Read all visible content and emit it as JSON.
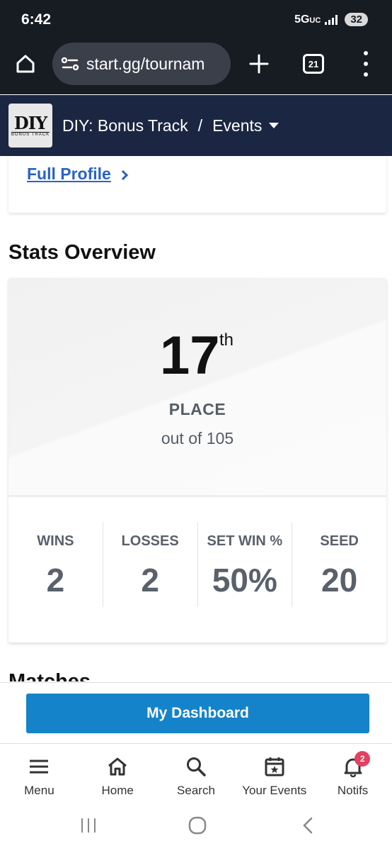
{
  "status_bar": {
    "time": "6:42",
    "network": "5G",
    "network_suffix": "UC",
    "battery": "32"
  },
  "browser": {
    "url": "start.gg/tournam",
    "tab_count": "21"
  },
  "header": {
    "event_name": "DIY: Bonus Track",
    "separator": "/",
    "section": "Events",
    "logo_main": "DIY",
    "logo_sub": "BONUS TRACK"
  },
  "profile": {
    "full_profile_link": "Full Profile"
  },
  "stats": {
    "title": "Stats Overview",
    "placement": {
      "number": "17",
      "suffix": "th",
      "label": "PLACE",
      "out_of": "out of 105"
    },
    "items": [
      {
        "label": "WINS",
        "value": "2"
      },
      {
        "label": "LOSSES",
        "value": "2"
      },
      {
        "label": "SET WIN %",
        "value": "50%"
      },
      {
        "label": "SEED",
        "value": "20"
      }
    ]
  },
  "matches": {
    "title": "Matches"
  },
  "dashboard_button": "My Dashboard",
  "bottom_nav": [
    {
      "label": "Menu",
      "icon": "menu-icon"
    },
    {
      "label": "Home",
      "icon": "home-icon"
    },
    {
      "label": "Search",
      "icon": "search-icon"
    },
    {
      "label": "Your Events",
      "icon": "calendar-star-icon"
    },
    {
      "label": "Notifs",
      "icon": "bell-icon",
      "badge": "2"
    }
  ],
  "colors": {
    "chrome": "#171b22",
    "header": "#1b2742",
    "link": "#2962c9",
    "button": "#1583c9",
    "badge": "#e4405f"
  }
}
